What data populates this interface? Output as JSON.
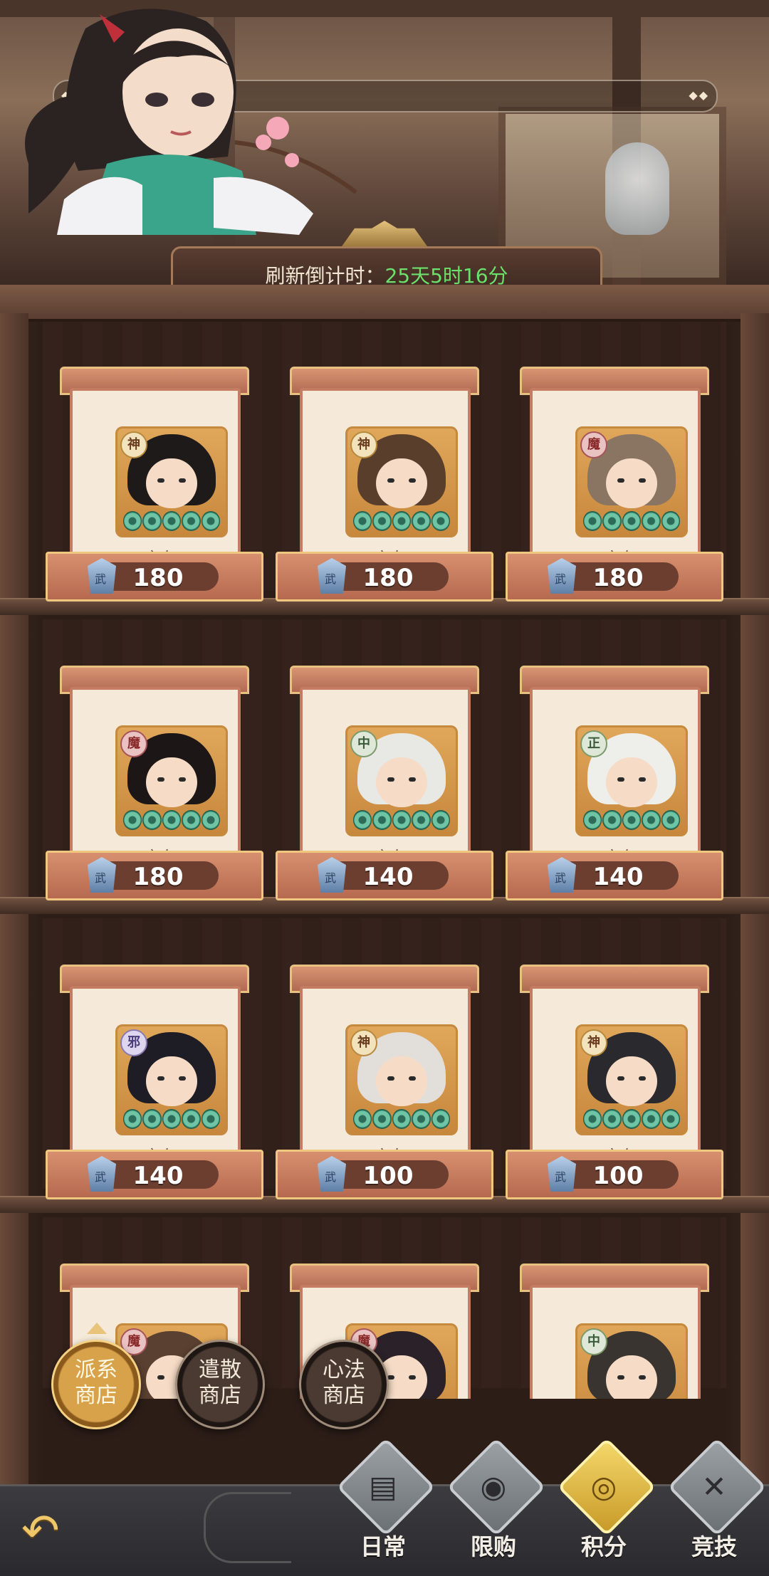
{
  "header": {
    "refresh_label": "刷新倒计时：",
    "refresh_timer": "25天5时16分"
  },
  "items": [
    {
      "faction": "神",
      "stock": "库存：20",
      "price": "180",
      "hair": "#1f1a1a"
    },
    {
      "faction": "神",
      "stock": "库存：20",
      "price": "180",
      "hair": "#5a3e2c"
    },
    {
      "faction": "魔",
      "stock": "库存：20",
      "price": "180",
      "hair": "#8a7462"
    },
    {
      "faction": "魔",
      "stock": "库存：20",
      "price": "180",
      "hair": "#1c1616"
    },
    {
      "faction": "中",
      "stock": "库存：20",
      "price": "140",
      "hair": "#e8e8e4"
    },
    {
      "faction": "正",
      "stock": "库存：20",
      "price": "140",
      "hair": "#eeeeea"
    },
    {
      "faction": "邪",
      "stock": "库存：20",
      "price": "140",
      "hair": "#1e1c24"
    },
    {
      "faction": "神",
      "stock": "库存：20",
      "price": "100",
      "hair": "#e2dfda"
    },
    {
      "faction": "神",
      "stock": "库存：20",
      "price": "100",
      "hair": "#2a2a2e"
    },
    {
      "faction": "魔",
      "hair": "#5a4030"
    },
    {
      "faction": "魔",
      "hair": "#2a2228"
    },
    {
      "faction": "中",
      "hair": "#3a3430"
    }
  ],
  "shops": [
    {
      "line1": "派系",
      "line2": "商店",
      "active": true
    },
    {
      "line1": "遣散",
      "line2": "商店",
      "active": false
    },
    {
      "line1": "心法",
      "line2": "商店",
      "active": false
    }
  ],
  "tabs": [
    {
      "label": "日常",
      "icon": "cards-icon"
    },
    {
      "label": "限购",
      "icon": "coin-bag-icon"
    },
    {
      "label": "积分",
      "icon": "points-coin-icon",
      "active": true
    },
    {
      "label": "竞技",
      "icon": "crossed-swords-icon"
    }
  ]
}
